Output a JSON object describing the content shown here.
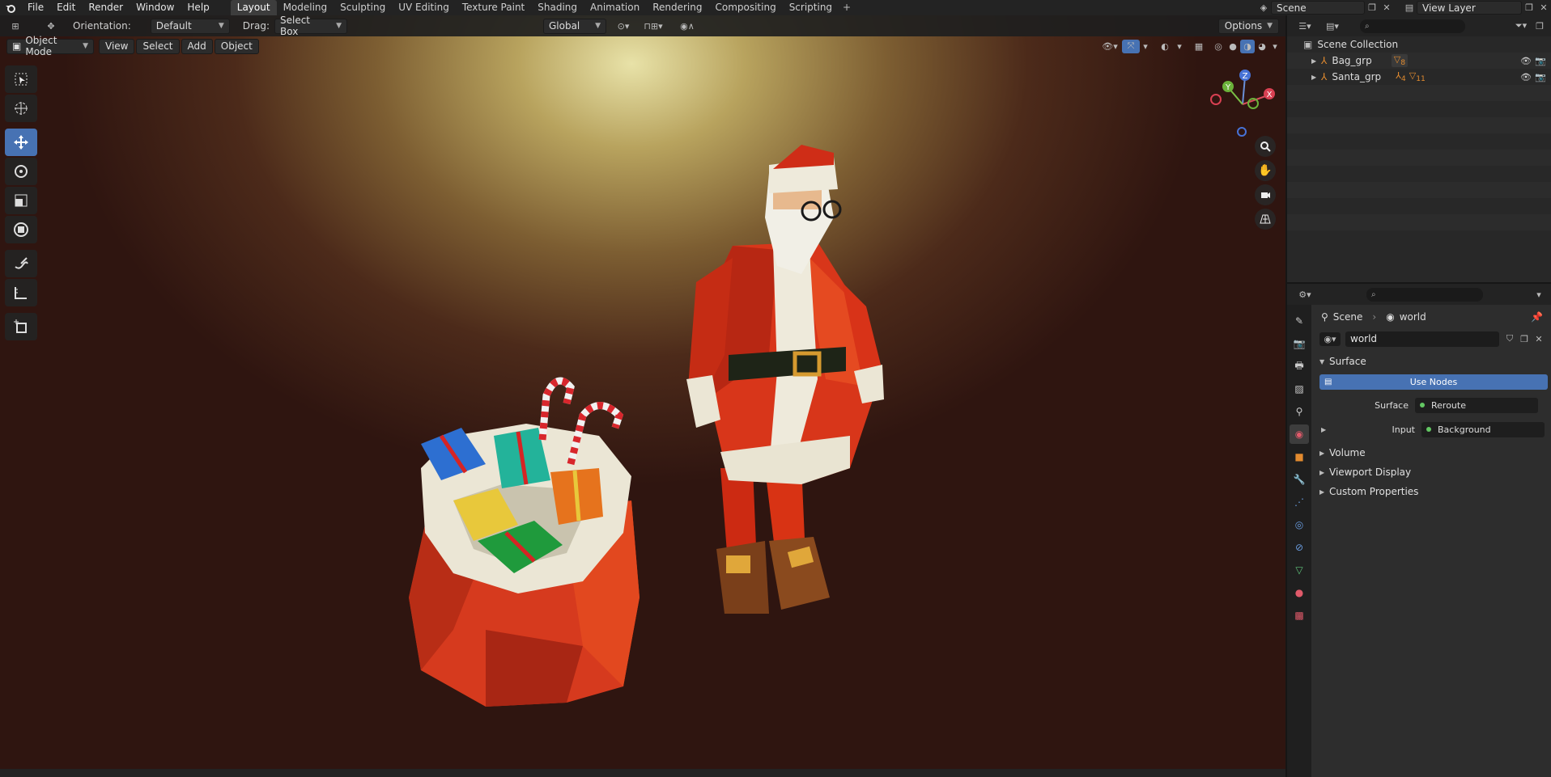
{
  "topbar": {
    "menus": [
      "File",
      "Edit",
      "Render",
      "Window",
      "Help"
    ],
    "workspaces": [
      "Layout",
      "Modeling",
      "Sculpting",
      "UV Editing",
      "Texture Paint",
      "Shading",
      "Animation",
      "Rendering",
      "Compositing",
      "Scripting"
    ],
    "active_workspace": "Layout",
    "scene_name": "Scene",
    "view_layer": "View Layer"
  },
  "viewport_header": {
    "orientation_label": "Orientation:",
    "orientation_value": "Default",
    "drag_label": "Drag:",
    "drag_value": "Select Box",
    "transform_orientation": "Global",
    "options_label": "Options"
  },
  "viewport_header2": {
    "mode": "Object Mode",
    "menus": [
      "View",
      "Select",
      "Add",
      "Object"
    ]
  },
  "gizmo": {
    "z": "Z",
    "y": "Y",
    "x": "X"
  },
  "outliner": {
    "root": "Scene Collection",
    "items": [
      {
        "name": "Bag_grp",
        "badge": "8"
      },
      {
        "name": "Santa_grp",
        "badge1": "4",
        "badge2": "11"
      }
    ]
  },
  "properties": {
    "breadcrumb_scene": "Scene",
    "breadcrumb_world": "world",
    "world_name": "world",
    "surface_panel": "Surface",
    "use_nodes": "Use Nodes",
    "surface_label": "Surface",
    "surface_value": "Reroute",
    "input_label": "Input",
    "input_value": "Background",
    "collapsed_panels": [
      "Volume",
      "Viewport Display",
      "Custom Properties"
    ]
  },
  "colors": {
    "accent": "#4772b3",
    "socket_green": "#63c763"
  }
}
